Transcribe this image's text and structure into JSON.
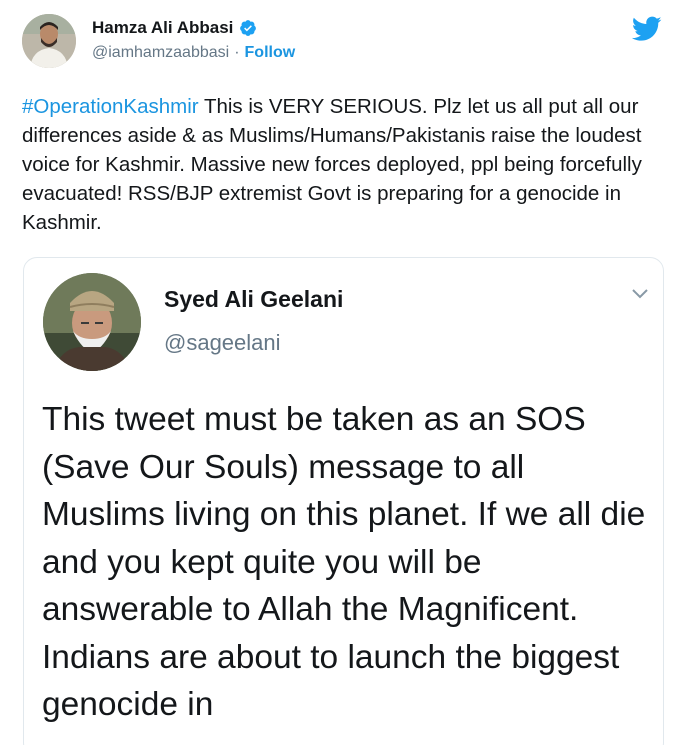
{
  "tweet": {
    "author": {
      "display_name": "Hamza Ali Abbasi",
      "handle": "@iamhamzaabbasi",
      "separator": "·",
      "follow_label": "Follow",
      "verified_icon": "verified-badge-icon"
    },
    "hashtag": "#OperationKashmir",
    "body": " This is VERY SERIOUS. Plz let us all put all our differences aside & as Muslims/Humans/Pakistanis raise the loudest voice for Kashmir. Massive new forces deployed, ppl being forcefully evacuated! RSS/BJP extremist Govt is preparing for a genocide in Kashmir.",
    "quoted": {
      "display_name": "Syed Ali Geelani",
      "handle": "@sageelani",
      "text": "This tweet must be taken as an SOS (Save Our Souls) message to all Muslims living on this planet. If we all die and you kept quite you will be answerable to Allah the Magnificent. Indians are about to launch the biggest genocide in"
    }
  },
  "colors": {
    "link": "#1b95e0",
    "text": "#14171a",
    "secondary": "#657786",
    "border": "#e1e8ed"
  }
}
